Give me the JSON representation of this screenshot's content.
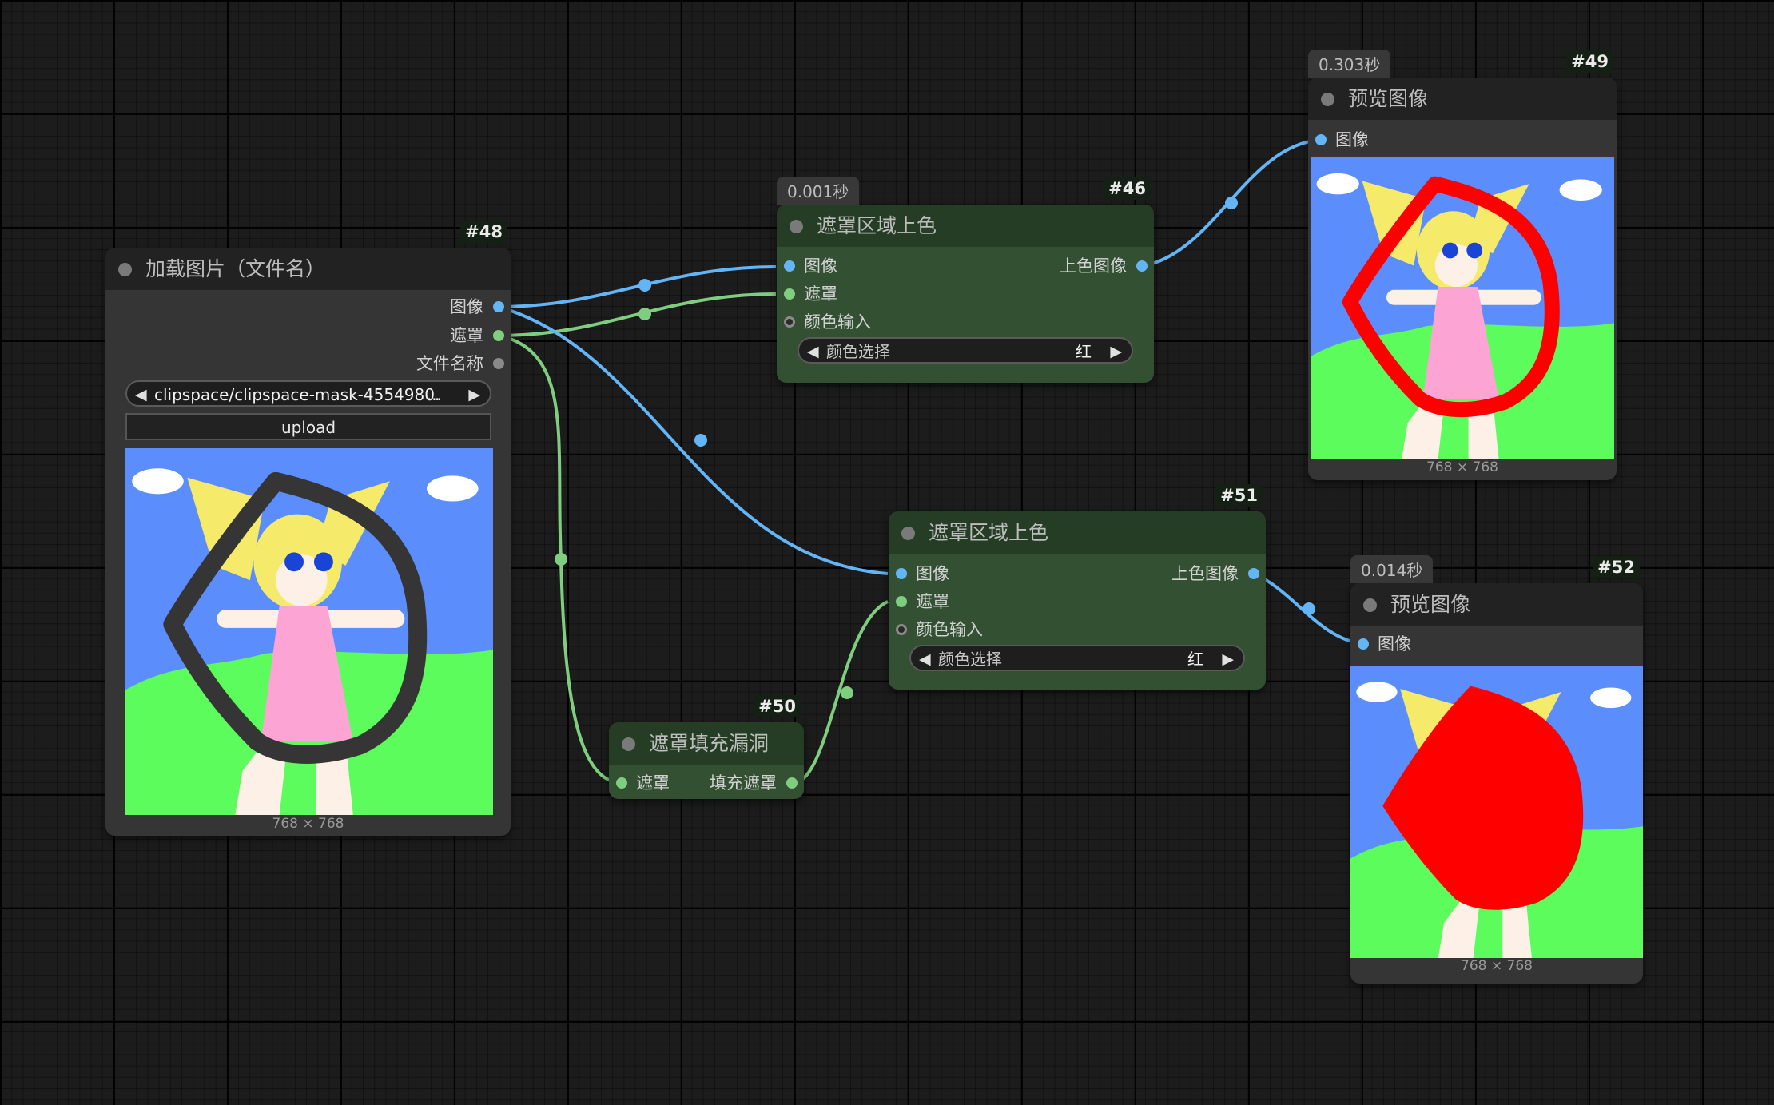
{
  "nodes": {
    "load_image": {
      "id": "#48",
      "title": "加载图片（文件名）",
      "outputs": [
        "图像",
        "遮罩",
        "文件名称"
      ],
      "file_value": "clipspace/clipspace-mask-4554980.",
      "file_ellipsis": "...",
      "upload_label": "upload",
      "dims": "768 × 768"
    },
    "mask_color_46": {
      "id": "#46",
      "timing": "0.001秒",
      "title": "遮罩区域上色",
      "inputs": [
        "图像",
        "遮罩",
        "颜色输入"
      ],
      "output": "上色图像",
      "combo_label": "颜色选择",
      "combo_value": "红"
    },
    "preview_49": {
      "id": "#49",
      "timing": "0.303秒",
      "title": "预览图像",
      "input": "图像",
      "dims": "768 × 768"
    },
    "mask_color_51": {
      "id": "#51",
      "title": "遮罩区域上色",
      "inputs": [
        "图像",
        "遮罩",
        "颜色输入"
      ],
      "output": "上色图像",
      "combo_label": "颜色选择",
      "combo_value": "红"
    },
    "fill_holes_50": {
      "id": "#50",
      "title": "遮罩填充漏洞",
      "input": "遮罩",
      "output": "填充遮罩"
    },
    "preview_52": {
      "id": "#52",
      "timing": "0.014秒",
      "title": "预览图像",
      "input": "图像",
      "dims": "768 × 768"
    }
  },
  "colors": {
    "image_wire": "#64b5f6",
    "mask_wire": "#7fce7f",
    "node_green": "#335033",
    "node_gray": "#353535",
    "canvas_bg": "#1c1c1c",
    "mask_red": "#ff0000"
  },
  "icons": [
    "collapse-dot-icon",
    "arrow-left-icon",
    "arrow-right-icon"
  ]
}
